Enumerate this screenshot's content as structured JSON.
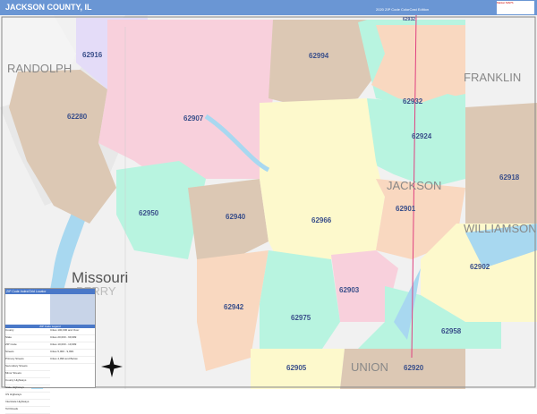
{
  "header": {
    "title": "JACKSON COUNTY, IL",
    "edition": "2020 ZIP Code ColorCast Edition",
    "logo_text": "Market MAPS"
  },
  "zips": {
    "z62916": "62916",
    "z62994": "62994",
    "z62932a": "62932",
    "z62932b": "62932",
    "z62280": "62280",
    "z62907": "62907",
    "z62924": "62924",
    "z62950": "62950",
    "z62940": "62940",
    "z62966": "62966",
    "z62901": "62901",
    "z62918": "62918",
    "z62902": "62902",
    "z62903": "62903",
    "z62942": "62942",
    "z62975": "62975",
    "z62958": "62958",
    "z62905": "62905",
    "z62920": "62920"
  },
  "counties": {
    "randolph": "RANDOLPH",
    "franklin": "FRANKLIN",
    "jackson": "JACKSON",
    "williamson": "WILLIAMSON",
    "missouri": "Missouri",
    "perry": "PERRY",
    "union": "UNION"
  },
  "legend": {
    "title": "ZIP Code Index/Grid Locator",
    "section2": "ZIP Code Legend",
    "rows": [
      "County",
      "State",
      "ZIP Code",
      "Streets",
      "Primary Streets",
      "Secondary Streets",
      "Minor Streets",
      "County Highways",
      "State Highways",
      "US Highways",
      "Interstate Highways",
      "Toll Roads"
    ],
    "cities": [
      "Cities 100,000 and Over",
      "Cities 20,000 - 99,999",
      "Cities 10,000 - 19,999",
      "Cities 5,000 - 9,999",
      "Cities 4,999 and Below"
    ]
  }
}
